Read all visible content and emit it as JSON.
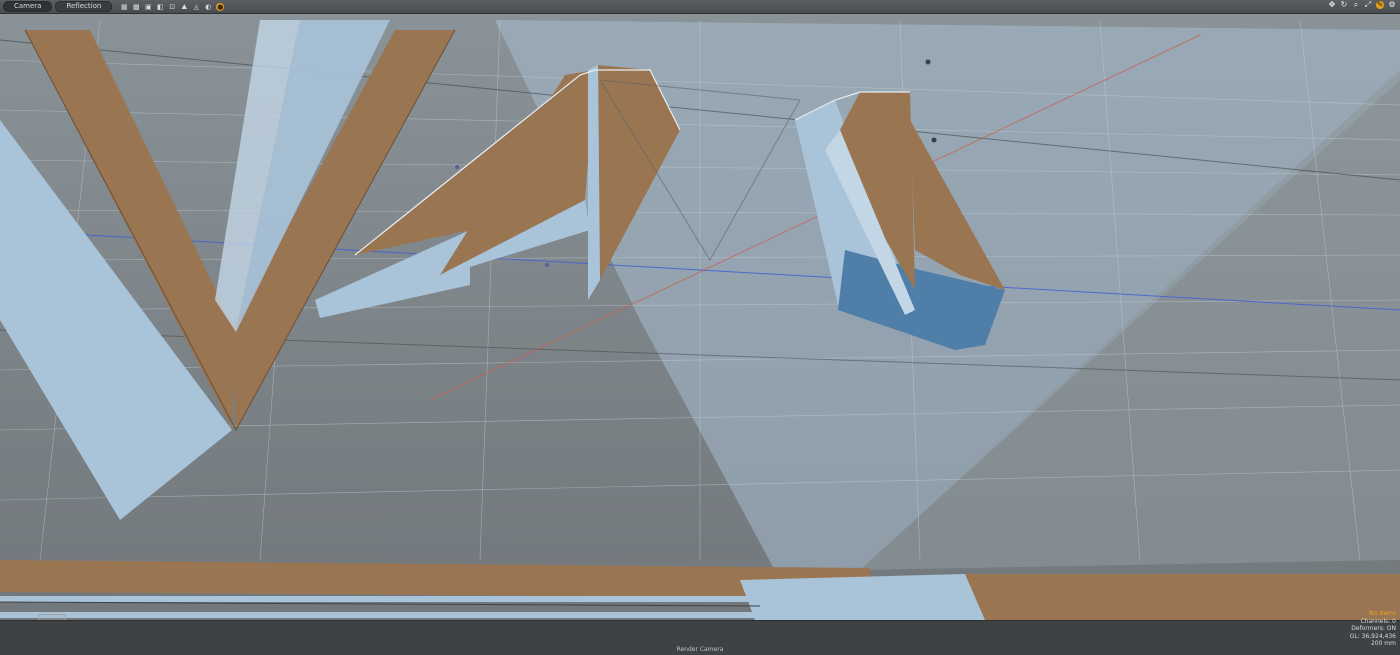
{
  "toolbar": {
    "tabs": [
      {
        "label": "Camera",
        "active": true
      },
      {
        "label": "Reflection",
        "active": false
      }
    ],
    "view_icons": [
      "grid-icon",
      "grid-dense-icon",
      "wireframe-icon",
      "shaded-icon",
      "texture-icon",
      "mountain-icon",
      "material-icon",
      "bulb-icon",
      "render-icon"
    ],
    "view_icon_glyphs": [
      "▦",
      "▩",
      "▣",
      "◧",
      "⊡",
      "⛰",
      "◬",
      "◐",
      "●"
    ],
    "nav_icons": [
      "move-icon",
      "rotate-icon",
      "zoom-icon",
      "fit-icon",
      "pan-icon",
      "settings-icon"
    ],
    "nav_icon_glyphs": [
      "✥",
      "↻",
      "⌕",
      "⤢",
      "✎",
      "⚙"
    ]
  },
  "viewport": {
    "label": "Render Camera",
    "info": {
      "no_items": "No Items",
      "channels": "Channels: 0",
      "deformers": "Deformers: ON",
      "gl": "GL: 36,924,436",
      "scale": "200 mm"
    }
  },
  "colors": {
    "background": "#7d858a",
    "tan_face": "#9a7552",
    "blue_face": "#a9c3d9",
    "dark_blue_face": "#4f7ea8",
    "grid_line": "#c9d3d9",
    "blue_axis": "#3f5fd6",
    "red_axis": "#d2584a",
    "highlight": "#e6a21a"
  }
}
